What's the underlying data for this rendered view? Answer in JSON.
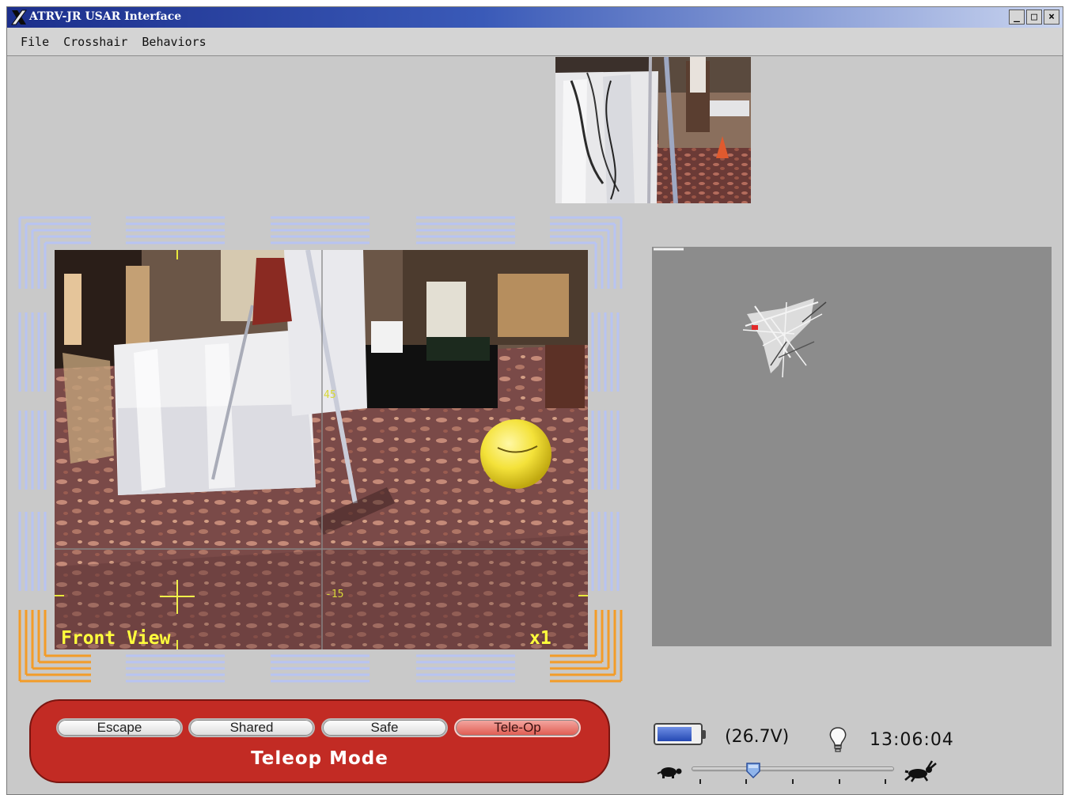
{
  "window": {
    "title": "ATRV-JR USAR Interface",
    "minimize": "_",
    "maximize": "□",
    "close": "×"
  },
  "menu": [
    "File",
    "Crosshair",
    "Behaviors"
  ],
  "front_view": {
    "label": "Front View",
    "zoom": "x1",
    "tilt_upper": "45",
    "tilt_lower": "-15"
  },
  "mode": {
    "title": "Teleop Mode",
    "buttons": [
      {
        "label": "Escape",
        "active": false
      },
      {
        "label": "Shared",
        "active": false
      },
      {
        "label": "Safe",
        "active": false
      },
      {
        "label": "Tele-Op",
        "active": true
      }
    ]
  },
  "status": {
    "voltage": "(26.7V)",
    "battery_level": 0.85,
    "clock": "13:06:04",
    "speed_level": 0.3,
    "icons": [
      "battery-icon",
      "light-bulb-icon",
      "turtle-icon",
      "rabbit-icon"
    ]
  },
  "colors": {
    "titlebar": "#1c2f8c",
    "sensor_idle": "#b8c4f2",
    "sensor_near": "#f39c28",
    "mode_panel": "#c22b24",
    "overlay_text": "#ffff3c",
    "map_background": "#8c8c8c"
  }
}
